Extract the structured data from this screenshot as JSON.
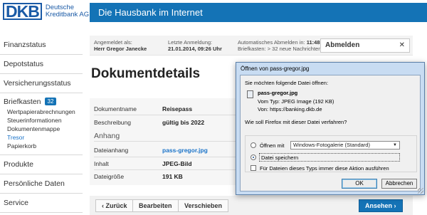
{
  "brand": {
    "name": "DKB",
    "line1": "Deutsche",
    "line2": "Kreditbank AG",
    "color": "#1a5aa6"
  },
  "banner": {
    "title": "Die Hausbank im Internet",
    "color": "#1473b6"
  },
  "sidebar": {
    "items_top": [
      {
        "label": "Finanzstatus"
      },
      {
        "label": "Depotstatus"
      },
      {
        "label": "Versicherungsstatus"
      }
    ],
    "briefkasten": {
      "label": "Briefkasten",
      "badge": "32",
      "subitems": [
        {
          "label": "Wertpapierabrechnungen",
          "active": false
        },
        {
          "label": "Steuerinformationen",
          "active": false
        },
        {
          "label": "Dokumentenmappe",
          "active": false
        },
        {
          "label": "Tresor",
          "active": true
        },
        {
          "label": "Papierkorb",
          "active": false
        }
      ]
    },
    "items_bottom": [
      {
        "label": "Produkte"
      },
      {
        "label": "Persönliche Daten"
      },
      {
        "label": "Service"
      }
    ]
  },
  "info": {
    "login_label": "Angemeldet als:",
    "login_value": "Herr Gregor Janecke",
    "last_label": "Letzte Anmeldung:",
    "last_value": "21.01.2014, 09:26 Uhr",
    "auto_label": "Automatisches Abmelden in:",
    "auto_value": "11:48 Min",
    "mail_label": "Briefkasten:",
    "mail_value": "> 32 neue Nachrichten",
    "logout_label": "Abmelden",
    "logout_icon": "close-icon"
  },
  "main": {
    "title": "Dokumentdetails",
    "rows": [
      {
        "label": "Dokumentname",
        "value": "Reisepass"
      },
      {
        "label": "Beschreibung",
        "value": "gültig bis 2022"
      }
    ],
    "section": "Anhang",
    "attachment_rows": [
      {
        "label": "Dateianhang",
        "value": "pass-gregor.jpg"
      },
      {
        "label": "Inhalt",
        "value": "JPEG-Bild"
      },
      {
        "label": "Dateigröße",
        "value": "191 KB"
      }
    ]
  },
  "footer": {
    "back": "‹ Zurück",
    "edit": "Bearbeiten",
    "move": "Verschieben",
    "view": "Ansehen ›"
  },
  "dialog": {
    "title": "Öffnen von pass-gregor.jpg",
    "intro": "Sie möchten folgende Datei öffnen:",
    "filename": "pass-gregor.jpg",
    "type_label": "Vom Typ:",
    "type_value": "JPEG Image (192 KB)",
    "from_label": "Von:",
    "from_value": "https://banking.dkb.de",
    "question": "Wie soll Firefox mit dieser Datei verfahren?",
    "open_with_label": "Öffnen mit",
    "open_with_value": "Windows-Fotogalerie (Standard)",
    "save_label": "Datei speichern",
    "save_selected": true,
    "always_label": "Für Dateien dieses Typs immer diese Aktion ausführen",
    "ok_label": "OK",
    "cancel_label": "Abbrechen"
  }
}
